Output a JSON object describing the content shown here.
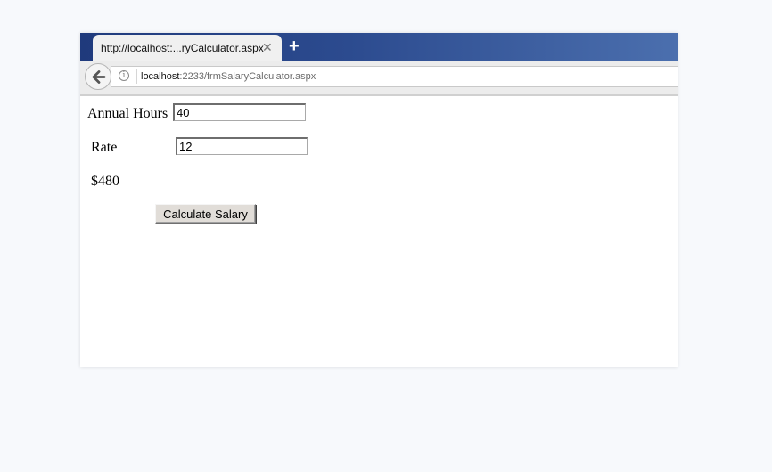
{
  "browser": {
    "tab_title": "http://localhost:...ryCalculator.aspx",
    "tab_close": "✕",
    "new_tab": "+",
    "url_host": "localhost",
    "url_path": ":2233/frmSalaryCalculator.aspx",
    "info_glyph": "i"
  },
  "form": {
    "annual_hours_label": "Annual Hours",
    "annual_hours_value": "40",
    "rate_label": "Rate",
    "rate_value": "12",
    "result_text": "$480",
    "calculate_button_label": "Calculate Salary"
  },
  "icons": {
    "back": "back-arrow-icon",
    "info": "info-icon",
    "close": "close-icon",
    "new_tab": "plus-icon"
  },
  "colors": {
    "tabbar_start": "#1f3a7c",
    "tabbar_end": "#4b6fae",
    "button_face": "#e1ddd8"
  }
}
